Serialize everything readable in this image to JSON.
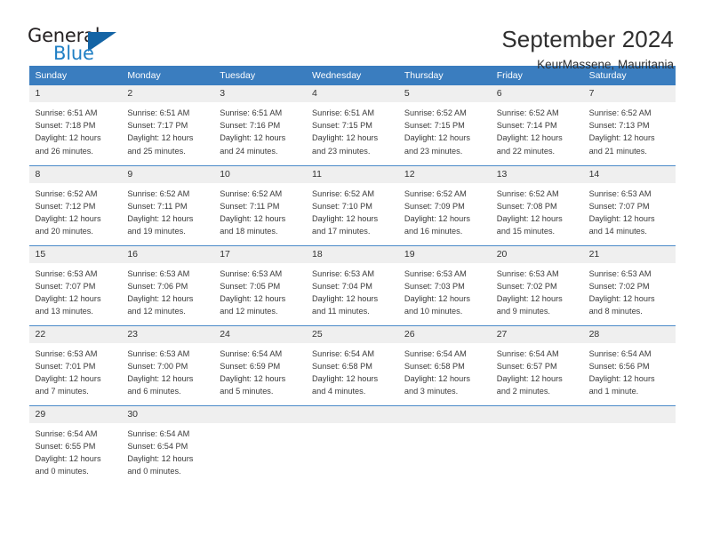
{
  "logo": {
    "word_top": "General",
    "word_bottom": "Blue",
    "triangle_color": "#1464a5",
    "blue_color": "#1f7fc4"
  },
  "header": {
    "title": "September 2024",
    "subtitle": "KeurMassene, Mauritania"
  },
  "theme": {
    "header_row_bg": "#3a7dbf",
    "daynum_bg": "#efefef",
    "grid_line": "#4a89c8",
    "text": "#3a3a3a"
  },
  "weekdays": [
    "Sunday",
    "Monday",
    "Tuesday",
    "Wednesday",
    "Thursday",
    "Friday",
    "Saturday"
  ],
  "weeks": [
    [
      {
        "day": "1",
        "sunrise": "Sunrise: 6:51 AM",
        "sunset": "Sunset: 7:18 PM",
        "daylight1": "Daylight: 12 hours",
        "daylight2": "and 26 minutes."
      },
      {
        "day": "2",
        "sunrise": "Sunrise: 6:51 AM",
        "sunset": "Sunset: 7:17 PM",
        "daylight1": "Daylight: 12 hours",
        "daylight2": "and 25 minutes."
      },
      {
        "day": "3",
        "sunrise": "Sunrise: 6:51 AM",
        "sunset": "Sunset: 7:16 PM",
        "daylight1": "Daylight: 12 hours",
        "daylight2": "and 24 minutes."
      },
      {
        "day": "4",
        "sunrise": "Sunrise: 6:51 AM",
        "sunset": "Sunset: 7:15 PM",
        "daylight1": "Daylight: 12 hours",
        "daylight2": "and 23 minutes."
      },
      {
        "day": "5",
        "sunrise": "Sunrise: 6:52 AM",
        "sunset": "Sunset: 7:15 PM",
        "daylight1": "Daylight: 12 hours",
        "daylight2": "and 23 minutes."
      },
      {
        "day": "6",
        "sunrise": "Sunrise: 6:52 AM",
        "sunset": "Sunset: 7:14 PM",
        "daylight1": "Daylight: 12 hours",
        "daylight2": "and 22 minutes."
      },
      {
        "day": "7",
        "sunrise": "Sunrise: 6:52 AM",
        "sunset": "Sunset: 7:13 PM",
        "daylight1": "Daylight: 12 hours",
        "daylight2": "and 21 minutes."
      }
    ],
    [
      {
        "day": "8",
        "sunrise": "Sunrise: 6:52 AM",
        "sunset": "Sunset: 7:12 PM",
        "daylight1": "Daylight: 12 hours",
        "daylight2": "and 20 minutes."
      },
      {
        "day": "9",
        "sunrise": "Sunrise: 6:52 AM",
        "sunset": "Sunset: 7:11 PM",
        "daylight1": "Daylight: 12 hours",
        "daylight2": "and 19 minutes."
      },
      {
        "day": "10",
        "sunrise": "Sunrise: 6:52 AM",
        "sunset": "Sunset: 7:11 PM",
        "daylight1": "Daylight: 12 hours",
        "daylight2": "and 18 minutes."
      },
      {
        "day": "11",
        "sunrise": "Sunrise: 6:52 AM",
        "sunset": "Sunset: 7:10 PM",
        "daylight1": "Daylight: 12 hours",
        "daylight2": "and 17 minutes."
      },
      {
        "day": "12",
        "sunrise": "Sunrise: 6:52 AM",
        "sunset": "Sunset: 7:09 PM",
        "daylight1": "Daylight: 12 hours",
        "daylight2": "and 16 minutes."
      },
      {
        "day": "13",
        "sunrise": "Sunrise: 6:52 AM",
        "sunset": "Sunset: 7:08 PM",
        "daylight1": "Daylight: 12 hours",
        "daylight2": "and 15 minutes."
      },
      {
        "day": "14",
        "sunrise": "Sunrise: 6:53 AM",
        "sunset": "Sunset: 7:07 PM",
        "daylight1": "Daylight: 12 hours",
        "daylight2": "and 14 minutes."
      }
    ],
    [
      {
        "day": "15",
        "sunrise": "Sunrise: 6:53 AM",
        "sunset": "Sunset: 7:07 PM",
        "daylight1": "Daylight: 12 hours",
        "daylight2": "and 13 minutes."
      },
      {
        "day": "16",
        "sunrise": "Sunrise: 6:53 AM",
        "sunset": "Sunset: 7:06 PM",
        "daylight1": "Daylight: 12 hours",
        "daylight2": "and 12 minutes."
      },
      {
        "day": "17",
        "sunrise": "Sunrise: 6:53 AM",
        "sunset": "Sunset: 7:05 PM",
        "daylight1": "Daylight: 12 hours",
        "daylight2": "and 12 minutes."
      },
      {
        "day": "18",
        "sunrise": "Sunrise: 6:53 AM",
        "sunset": "Sunset: 7:04 PM",
        "daylight1": "Daylight: 12 hours",
        "daylight2": "and 11 minutes."
      },
      {
        "day": "19",
        "sunrise": "Sunrise: 6:53 AM",
        "sunset": "Sunset: 7:03 PM",
        "daylight1": "Daylight: 12 hours",
        "daylight2": "and 10 minutes."
      },
      {
        "day": "20",
        "sunrise": "Sunrise: 6:53 AM",
        "sunset": "Sunset: 7:02 PM",
        "daylight1": "Daylight: 12 hours",
        "daylight2": "and 9 minutes."
      },
      {
        "day": "21",
        "sunrise": "Sunrise: 6:53 AM",
        "sunset": "Sunset: 7:02 PM",
        "daylight1": "Daylight: 12 hours",
        "daylight2": "and 8 minutes."
      }
    ],
    [
      {
        "day": "22",
        "sunrise": "Sunrise: 6:53 AM",
        "sunset": "Sunset: 7:01 PM",
        "daylight1": "Daylight: 12 hours",
        "daylight2": "and 7 minutes."
      },
      {
        "day": "23",
        "sunrise": "Sunrise: 6:53 AM",
        "sunset": "Sunset: 7:00 PM",
        "daylight1": "Daylight: 12 hours",
        "daylight2": "and 6 minutes."
      },
      {
        "day": "24",
        "sunrise": "Sunrise: 6:54 AM",
        "sunset": "Sunset: 6:59 PM",
        "daylight1": "Daylight: 12 hours",
        "daylight2": "and 5 minutes."
      },
      {
        "day": "25",
        "sunrise": "Sunrise: 6:54 AM",
        "sunset": "Sunset: 6:58 PM",
        "daylight1": "Daylight: 12 hours",
        "daylight2": "and 4 minutes."
      },
      {
        "day": "26",
        "sunrise": "Sunrise: 6:54 AM",
        "sunset": "Sunset: 6:58 PM",
        "daylight1": "Daylight: 12 hours",
        "daylight2": "and 3 minutes."
      },
      {
        "day": "27",
        "sunrise": "Sunrise: 6:54 AM",
        "sunset": "Sunset: 6:57 PM",
        "daylight1": "Daylight: 12 hours",
        "daylight2": "and 2 minutes."
      },
      {
        "day": "28",
        "sunrise": "Sunrise: 6:54 AM",
        "sunset": "Sunset: 6:56 PM",
        "daylight1": "Daylight: 12 hours",
        "daylight2": "and 1 minute."
      }
    ],
    [
      {
        "day": "29",
        "sunrise": "Sunrise: 6:54 AM",
        "sunset": "Sunset: 6:55 PM",
        "daylight1": "Daylight: 12 hours",
        "daylight2": "and 0 minutes."
      },
      {
        "day": "30",
        "sunrise": "Sunrise: 6:54 AM",
        "sunset": "Sunset: 6:54 PM",
        "daylight1": "Daylight: 12 hours",
        "daylight2": "and 0 minutes."
      },
      {
        "day": "",
        "sunrise": "",
        "sunset": "",
        "daylight1": "",
        "daylight2": ""
      },
      {
        "day": "",
        "sunrise": "",
        "sunset": "",
        "daylight1": "",
        "daylight2": ""
      },
      {
        "day": "",
        "sunrise": "",
        "sunset": "",
        "daylight1": "",
        "daylight2": ""
      },
      {
        "day": "",
        "sunrise": "",
        "sunset": "",
        "daylight1": "",
        "daylight2": ""
      },
      {
        "day": "",
        "sunrise": "",
        "sunset": "",
        "daylight1": "",
        "daylight2": ""
      }
    ]
  ]
}
